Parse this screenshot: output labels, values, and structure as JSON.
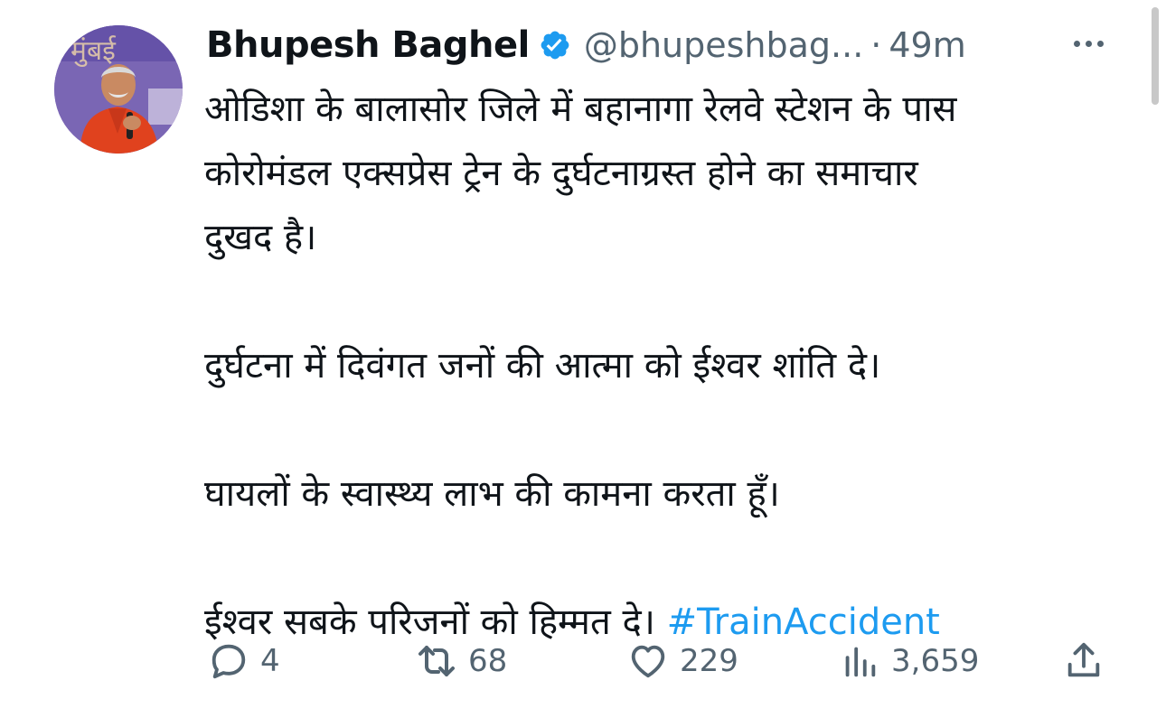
{
  "author": {
    "display_name": "Bhupesh Baghel",
    "handle": "@bhupeshbag...",
    "separator": "·",
    "time": "49m",
    "verified_icon": "verified-badge-icon",
    "avatar_text": "मुंबई"
  },
  "tweet": {
    "lines_p1": [
      "ओडिशा के बालासोर जिले में बहानागा रेलवे स्टेशन के पास",
      "कोरोमंडल एक्सप्रेस ट्रेन के दुर्घटनाग्रस्त होने का समाचार",
      "दुखद है।"
    ],
    "p2": "दुर्घटना में दिवंगत जनों की आत्मा को ईश्वर शांति दे।",
    "p3": "घायलों के स्वास्थ्य लाभ की कामना करता हूँ।",
    "p4_text": "ईश्वर सबके परिजनों को हिम्मत दे।",
    "hashtag": "#TrainAccident"
  },
  "actions": {
    "reply": {
      "icon": "reply-icon",
      "count": "4"
    },
    "retweet": {
      "icon": "retweet-icon",
      "count": "68"
    },
    "like": {
      "icon": "heart-icon",
      "count": "229"
    },
    "views": {
      "icon": "views-chart-icon",
      "count": "3,659"
    },
    "share": {
      "icon": "share-icon"
    }
  },
  "colors": {
    "text": "#0f1419",
    "secondary": "#536471",
    "link": "#1d9bf0",
    "verified": "#1d9bf0"
  }
}
